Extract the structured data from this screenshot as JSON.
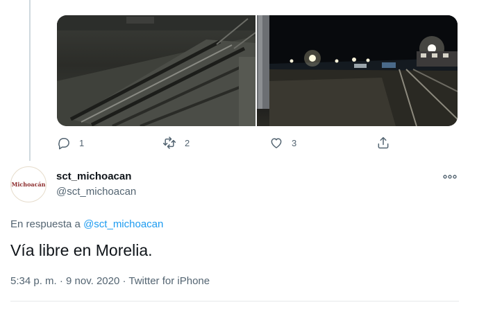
{
  "media": {
    "photos": [
      {
        "name": "railroad-crossing-night-photo"
      },
      {
        "name": "train-tracks-lights-night-photo"
      }
    ]
  },
  "actions": {
    "reply": {
      "icon": "reply-icon",
      "count": "1"
    },
    "retweet": {
      "icon": "retweet-icon",
      "count": "2"
    },
    "like": {
      "icon": "heart-icon",
      "count": "3"
    },
    "share": {
      "icon": "share-icon"
    }
  },
  "tweet": {
    "avatar_text": "Michoacán",
    "display_name": "sct_michoacan",
    "handle": "@sct_michoacan",
    "more_icon": "more-icon",
    "reply_prefix": "En respuesta a",
    "reply_handle": "@sct_michoacan",
    "text": "Vía libre en Morelia.",
    "meta": "5:34 p. m. · 9 nov. 2020 · Twitter for iPhone"
  },
  "colors": {
    "link": "#1d9bf0",
    "secondary_text": "#536471",
    "primary_text": "#0f1419"
  }
}
